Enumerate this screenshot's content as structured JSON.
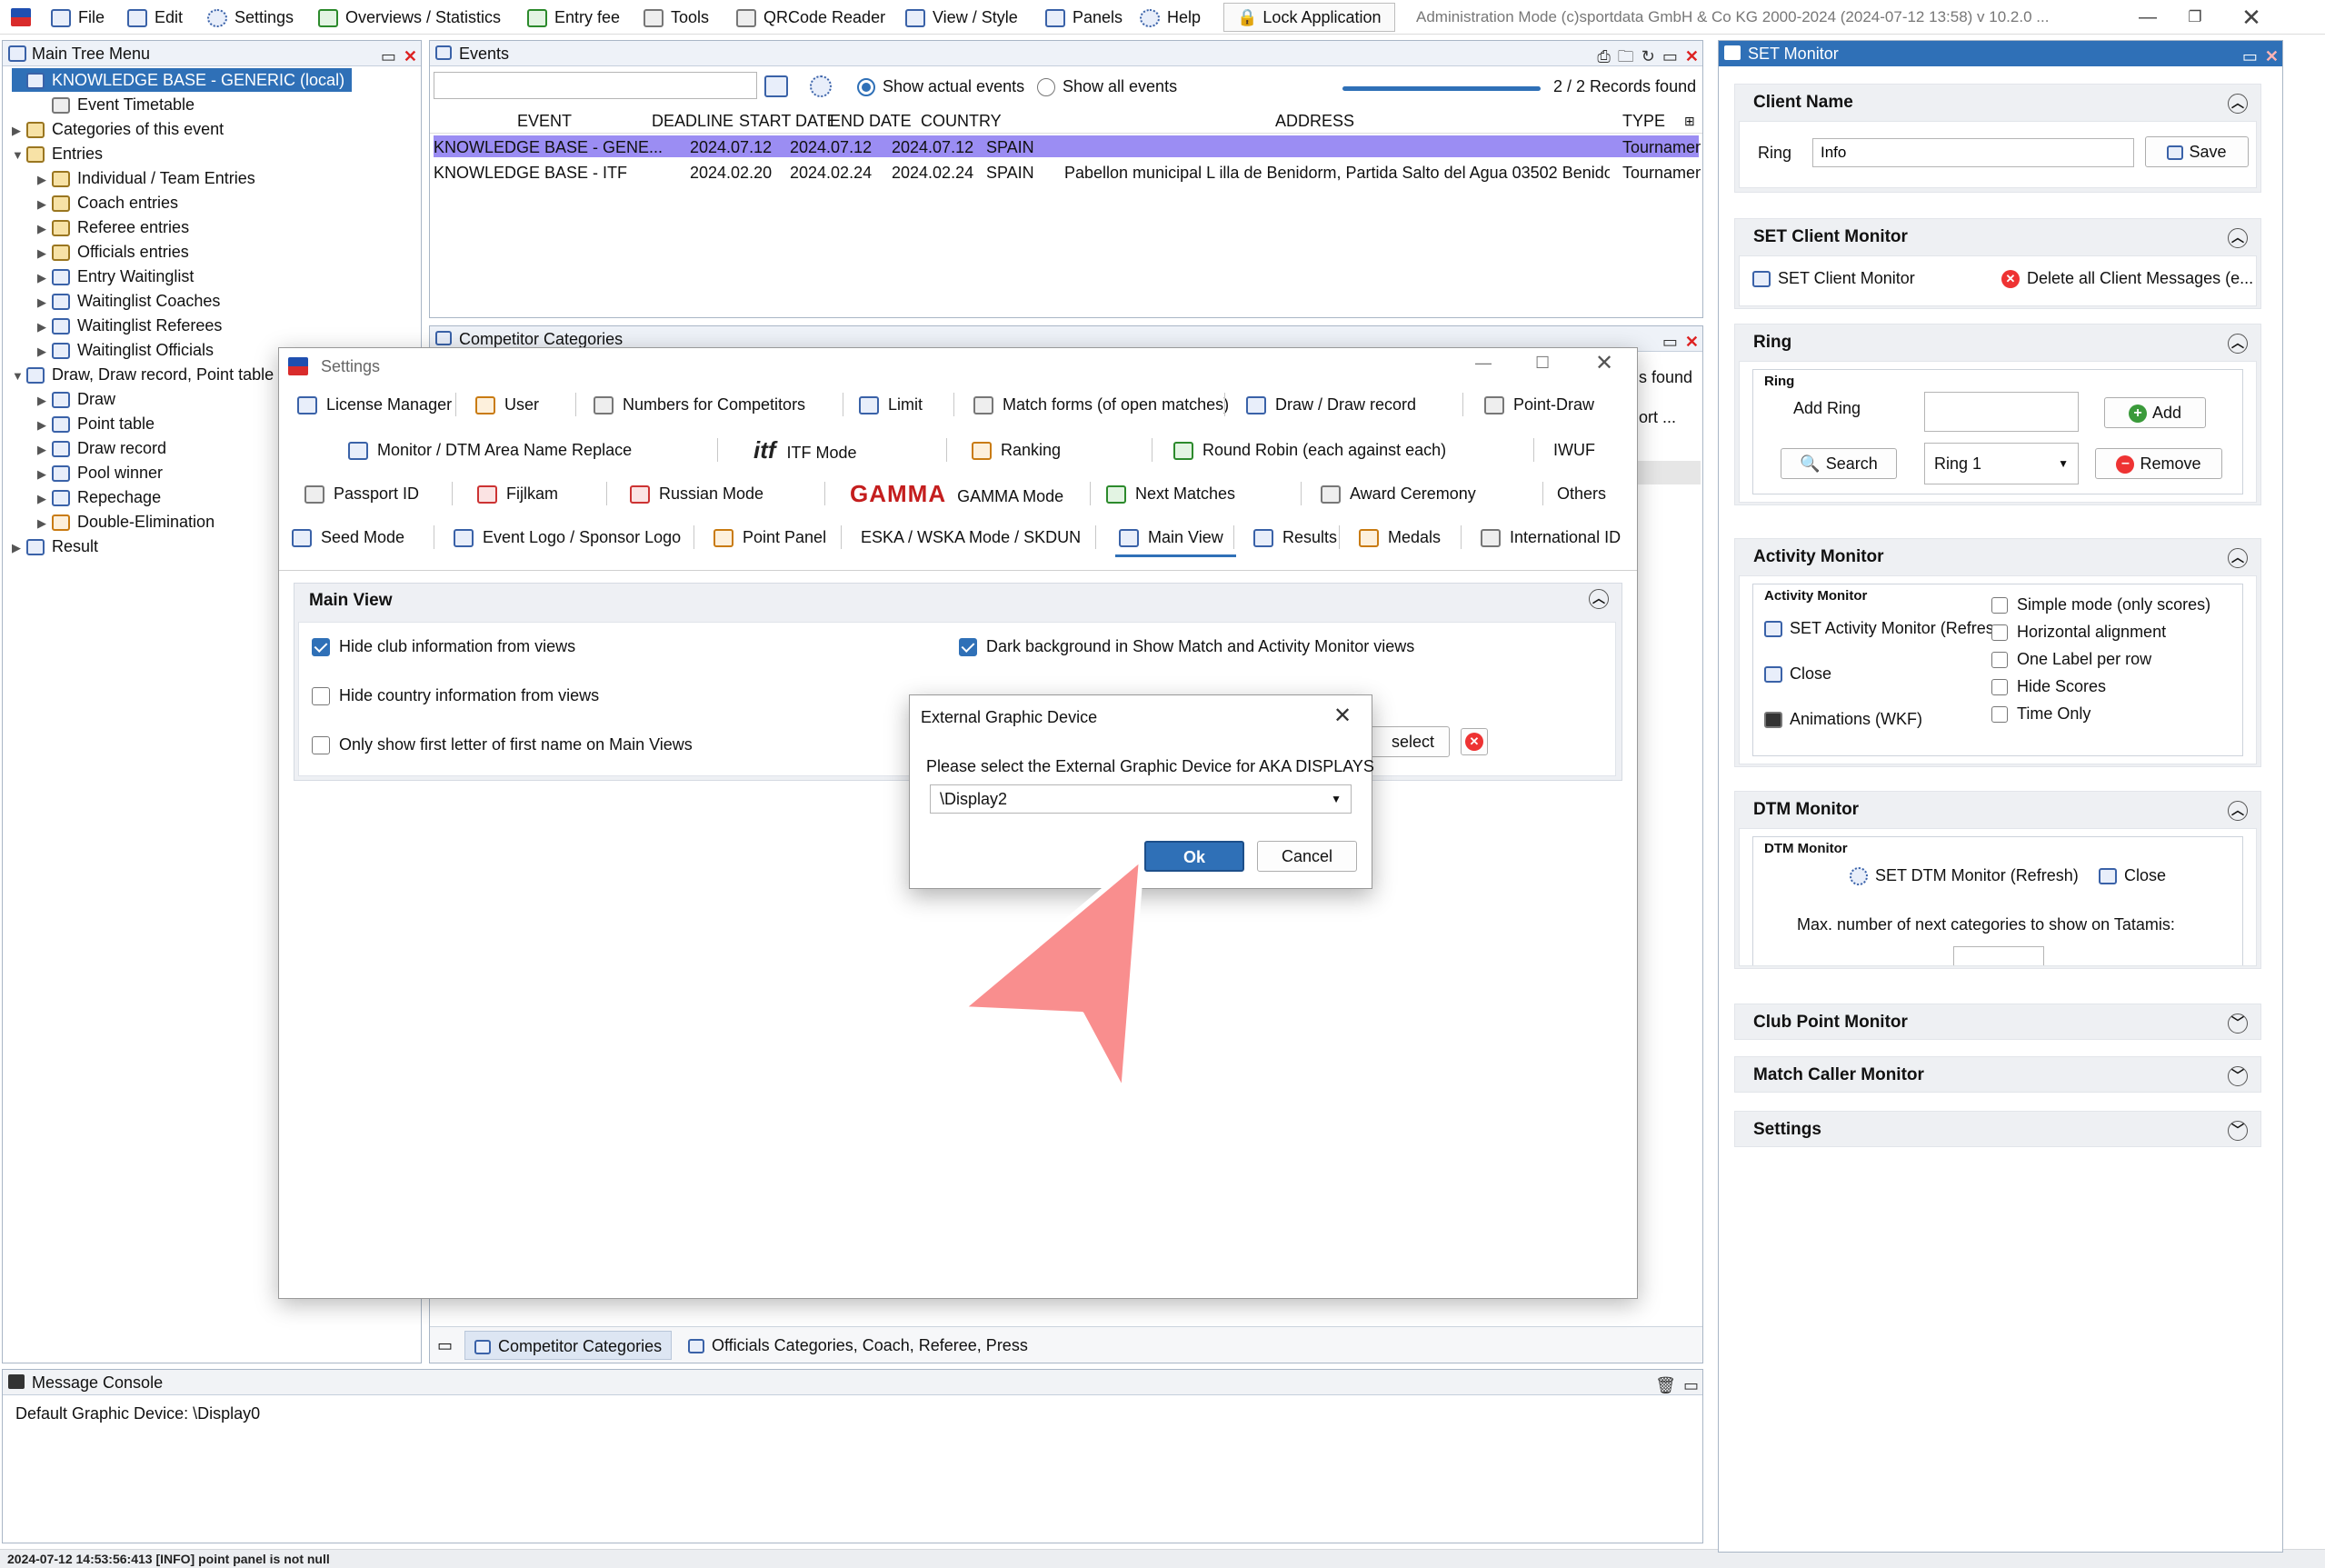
{
  "menubar": {
    "items": [
      {
        "label": "File",
        "icon": "file-icon"
      },
      {
        "label": "Edit",
        "icon": "edit-icon"
      },
      {
        "label": "Settings",
        "icon": "gear-icon"
      },
      {
        "label": "Overviews / Statistics",
        "icon": "chart-icon"
      },
      {
        "label": "Entry fee",
        "icon": "money-icon"
      },
      {
        "label": "Tools",
        "icon": "wrench-icon"
      },
      {
        "label": "QRCode Reader",
        "icon": "qrcode-icon"
      },
      {
        "label": "View / Style",
        "icon": "view-icon"
      },
      {
        "label": "Panels",
        "icon": "panels-icon"
      },
      {
        "label": "Help",
        "icon": "help-icon"
      }
    ],
    "lock_label": "Lock Application",
    "status": "Administration Mode (c)sportdata GmbH & Co KG 2000-2024 (2024-07-12 13:58)  v 10.2.0 ..."
  },
  "tree": {
    "title": "Main Tree Menu",
    "rows": [
      {
        "label": "KNOWLEDGE BASE - GENERIC (local)",
        "level": 0,
        "arrow": "",
        "selected": true
      },
      {
        "label": "Event Timetable",
        "level": 1,
        "arrow": ""
      },
      {
        "label": "Categories of this event",
        "level": 0,
        "arrow": "▶"
      },
      {
        "label": "Entries",
        "level": 0,
        "arrow": "▼"
      },
      {
        "label": "Individual / Team Entries",
        "level": 1,
        "arrow": "▶"
      },
      {
        "label": "Coach entries",
        "level": 1,
        "arrow": "▶"
      },
      {
        "label": "Referee entries",
        "level": 1,
        "arrow": "▶"
      },
      {
        "label": "Officials entries",
        "level": 1,
        "arrow": "▶"
      },
      {
        "label": "Entry Waitinglist",
        "level": 1,
        "arrow": "▶"
      },
      {
        "label": "Waitinglist Coaches",
        "level": 1,
        "arrow": "▶"
      },
      {
        "label": "Waitinglist Referees",
        "level": 1,
        "arrow": "▶"
      },
      {
        "label": "Waitinglist Officials",
        "level": 1,
        "arrow": "▶"
      },
      {
        "label": "Draw, Draw record, Point table",
        "level": 0,
        "arrow": "▼"
      },
      {
        "label": "Draw",
        "level": 1,
        "arrow": "▶"
      },
      {
        "label": "Point table",
        "level": 1,
        "arrow": "▶"
      },
      {
        "label": "Draw record",
        "level": 1,
        "arrow": "▶"
      },
      {
        "label": "Pool winner",
        "level": 1,
        "arrow": "▶"
      },
      {
        "label": "Repechage",
        "level": 1,
        "arrow": "▶"
      },
      {
        "label": "Double-Elimination",
        "level": 1,
        "arrow": "▶"
      },
      {
        "label": "Result",
        "level": 0,
        "arrow": "▶"
      }
    ]
  },
  "events": {
    "title": "Events",
    "search_value": "",
    "radio_actual": "Show actual events",
    "radio_all": "Show all events",
    "records": "2 / 2 Records found",
    "columns": [
      "EVENT",
      "DEADLINE",
      "START DATE",
      "END DATE",
      "COUNTRY",
      "ADDRESS",
      "TYPE"
    ],
    "rows": [
      [
        "KNOWLEDGE BASE - GENE...",
        "2024.07.12",
        "2024.07.12",
        "2024.07.12",
        "SPAIN",
        "",
        "Tournament"
      ],
      [
        "KNOWLEDGE BASE - ITF",
        "2024.02.20",
        "2024.02.24",
        "2024.02.24",
        "SPAIN",
        "Pabellon municipal L illa de Benidorm, Partida Salto del Agua 03502 Benidorm...",
        "Tournament"
      ]
    ]
  },
  "categories_panel": {
    "title": "Competitor Categories",
    "records_partial": "ds found",
    "short_partial": "hort ...",
    "tab1": "Competitor Categories",
    "tab2": "Officials Categories, Coach, Referee, Press"
  },
  "settings": {
    "title": "Settings",
    "tabs_row1": [
      "License Manager",
      "User",
      "Numbers for Competitors",
      "Limit",
      "Match forms (of open matches)",
      "Draw / Draw record",
      "Point-Draw"
    ],
    "tabs_row2": [
      "Monitor / DTM Area Name Replace",
      "ITF Mode",
      "Ranking",
      "Round Robin (each against each)",
      "IWUF"
    ],
    "tabs_row3": [
      "Passport ID",
      "Fijlkam",
      "Russian Mode",
      "GAMMA Mode",
      "Next Matches",
      "Award Ceremony",
      "Others"
    ],
    "tabs_row4": [
      "Seed Mode",
      "Event Logo / Sponsor Logo",
      "Point Panel",
      "ESKA / WSKA Mode / SKDUN",
      "Main View",
      "Results",
      "Medals",
      "International ID"
    ],
    "itf_logo": "itf",
    "gamma_logo": "GAMMA",
    "section_title": "Main View",
    "options": [
      {
        "label": "Hide club information from views",
        "checked": true
      },
      {
        "label": "Hide country information from views",
        "checked": false
      },
      {
        "label": "Only show first letter of first name on Main Views",
        "checked": false
      },
      {
        "label": "Dark background in Show Match and Activity Monitor views",
        "checked": true
      }
    ],
    "select_partial": "select"
  },
  "modal": {
    "title": "External Graphic Device",
    "prompt": "Please select the External Graphic Device for AKA DISPLAYS",
    "selected": "\\Display2",
    "ok": "Ok",
    "cancel": "Cancel"
  },
  "set_monitor": {
    "title": "SET Monitor",
    "client_name": {
      "header": "Client Name",
      "label": "Ring",
      "value": "Info",
      "save": "Save"
    },
    "client_monitor": {
      "header": "SET Client Monitor",
      "open": "SET Client Monitor",
      "delete": "Delete all Client Messages (e..."
    },
    "ring": {
      "header": "Ring",
      "group": "Ring",
      "add_label": "Add Ring",
      "add_value": "",
      "add": "Add",
      "search": "Search",
      "ring_select": "Ring 1",
      "remove": "Remove"
    },
    "activity": {
      "header": "Activity Monitor",
      "group": "Activity Monitor",
      "open": "SET Activity Monitor (Refres...",
      "close": "Close",
      "animations": "Animations (WKF)",
      "options": [
        "Simple mode (only scores)",
        "Horizontal alignment",
        "One Label per row",
        "Hide Scores",
        "Time Only"
      ]
    },
    "dtm": {
      "header": "DTM Monitor",
      "group": "DTM Monitor",
      "open": "SET DTM Monitor (Refresh)",
      "close": "Close",
      "max_label": "Max. number of next categories to show on Tatamis:"
    },
    "collapsed": [
      "Club Point Monitor",
      "Match Caller Monitor",
      "Settings"
    ]
  },
  "console": {
    "title": "Message Console",
    "text": "Default Graphic Device: \\Display0",
    "status": "2024-07-12 14:53:56:413 [INFO] point panel is not null"
  },
  "colors": {
    "selection": "#2f70b7",
    "row_highlight": "#9b8df3",
    "primary_button": "#2f70b7",
    "arrow": "#f98e8e"
  }
}
